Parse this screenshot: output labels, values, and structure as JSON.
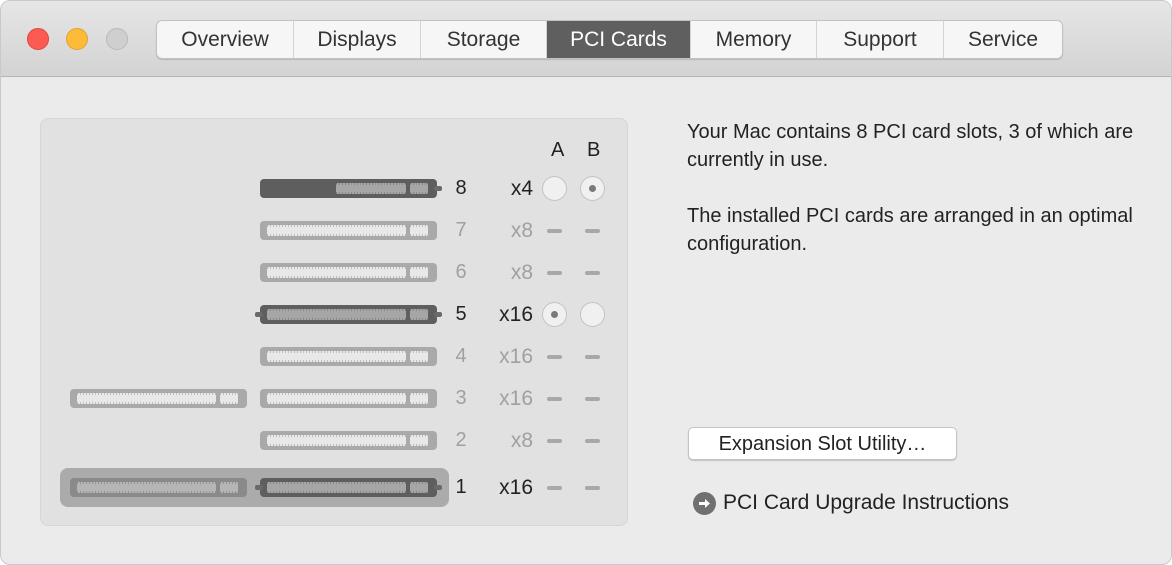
{
  "window": {
    "traffic_lights": [
      "close",
      "minimize",
      "zoom"
    ],
    "tabs": [
      {
        "label": "Overview",
        "active": false
      },
      {
        "label": "Displays",
        "active": false
      },
      {
        "label": "Storage",
        "active": false
      },
      {
        "label": "PCI Cards",
        "active": true
      },
      {
        "label": "Memory",
        "active": false
      },
      {
        "label": "Support",
        "active": false
      },
      {
        "label": "Service",
        "active": false
      }
    ]
  },
  "slots_panel": {
    "column_headers": {
      "a": "A",
      "b": "B"
    },
    "slots": [
      {
        "number": "8",
        "lanes": "x4",
        "in_use": true,
        "a": "empty",
        "b": "selected"
      },
      {
        "number": "7",
        "lanes": "x8",
        "in_use": false,
        "a": "none",
        "b": "none"
      },
      {
        "number": "6",
        "lanes": "x8",
        "in_use": false,
        "a": "none",
        "b": "none"
      },
      {
        "number": "5",
        "lanes": "x16",
        "in_use": true,
        "a": "selected",
        "b": "empty"
      },
      {
        "number": "4",
        "lanes": "x16",
        "in_use": false,
        "a": "none",
        "b": "none"
      },
      {
        "number": "3",
        "lanes": "x16",
        "in_use": false,
        "a": "none",
        "b": "none",
        "double_wide": true
      },
      {
        "number": "2",
        "lanes": "x8",
        "in_use": false,
        "a": "none",
        "b": "none"
      },
      {
        "number": "1",
        "lanes": "x16",
        "in_use": true,
        "a": "none",
        "b": "none",
        "double_wide": true,
        "highlighted": true
      }
    ]
  },
  "info": {
    "summary": "Your Mac contains 8 PCI card slots, 3 of which are currently in use.",
    "configuration": "The installed PCI cards are arranged in an optimal configuration.",
    "utility_button": "Expansion Slot Utility…",
    "upgrade_link": "PCI Card Upgrade Instructions"
  },
  "colors": {
    "active_tab": "#5f5f5f",
    "close": "#fd5a52",
    "minimize": "#fdbb38",
    "zoom": "#cfcfcf",
    "used_text": "#222222",
    "unused_text": "#a0a0a0"
  }
}
